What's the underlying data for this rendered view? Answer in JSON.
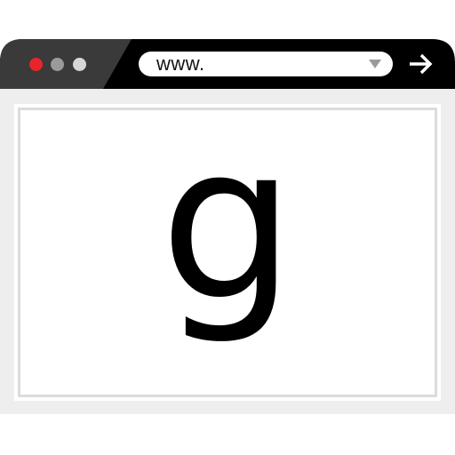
{
  "window": {
    "traffic_lights": [
      {
        "name": "close",
        "color": "#e8242b"
      },
      {
        "name": "minimize",
        "color": "#9a9a9a"
      },
      {
        "name": "maximize",
        "color": "#d6d6d6"
      }
    ],
    "title_bar_color": "#000000",
    "title_bar_left_color": "#3a3a3a",
    "content_background": "#eeeeee"
  },
  "address_bar": {
    "url_text": "www.",
    "dropdown_icon": "triangle-down-icon",
    "forward_icon": "arrow-right-icon"
  },
  "content": {
    "glyph": "g"
  }
}
